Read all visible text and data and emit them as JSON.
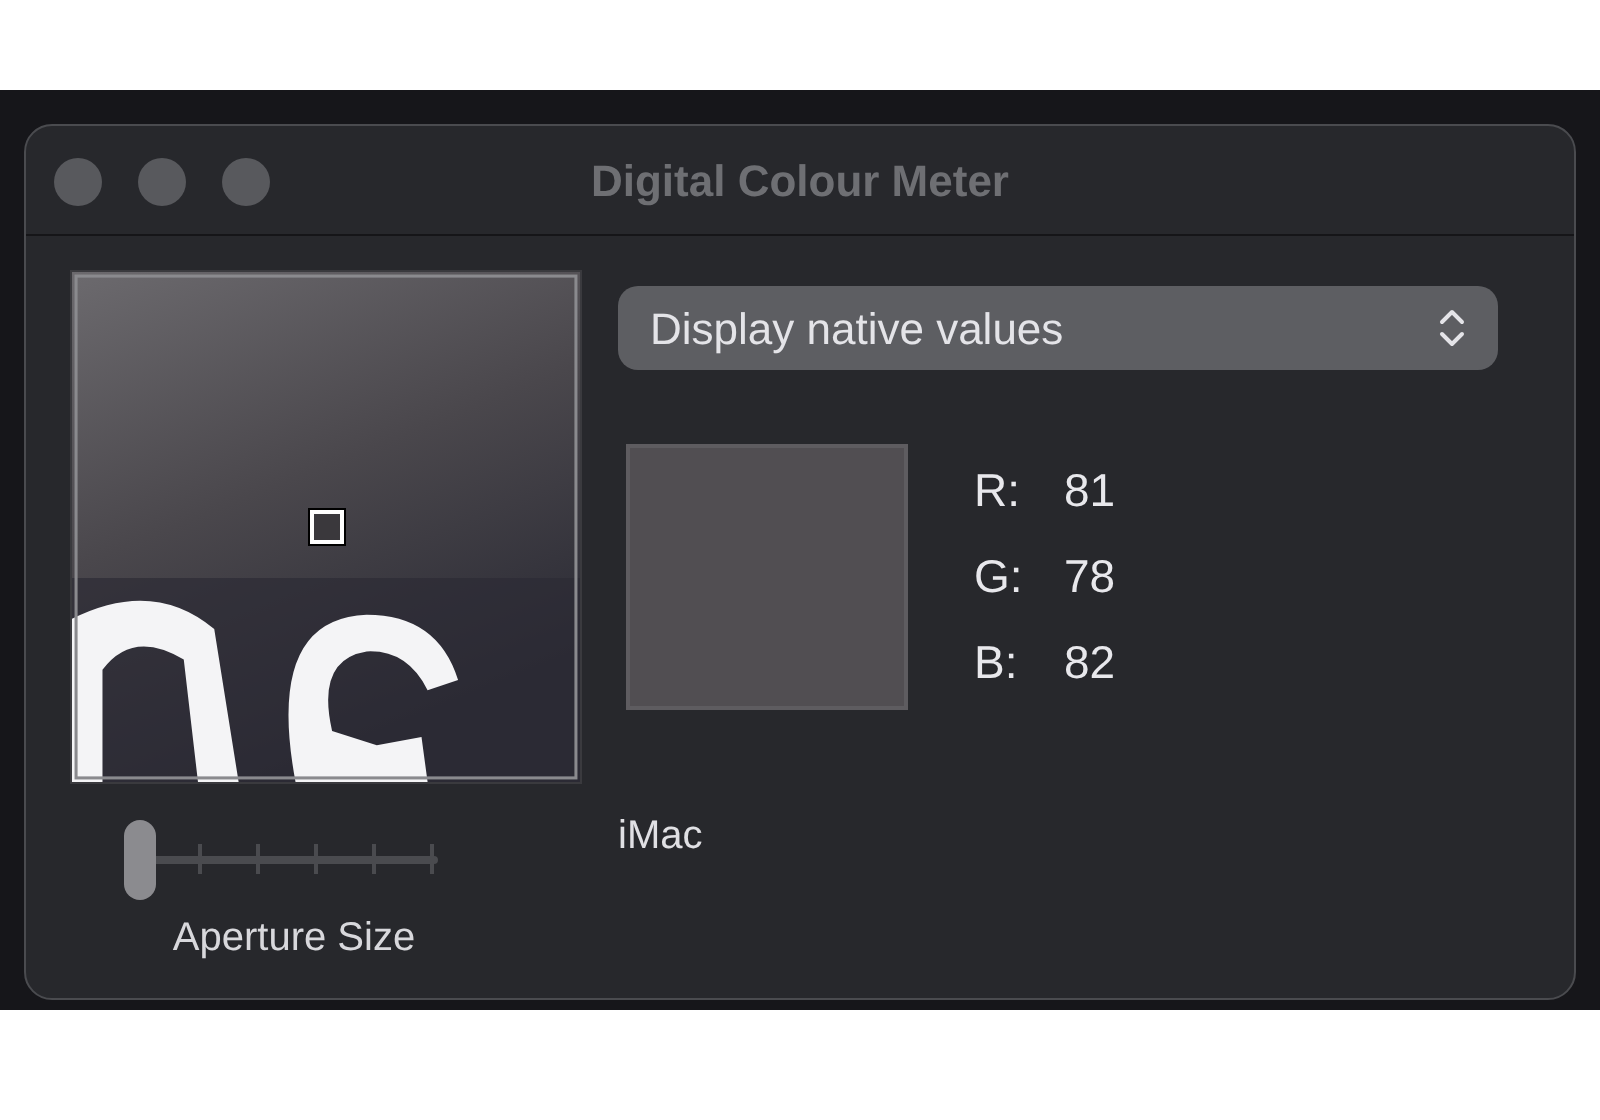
{
  "window": {
    "title": "Digital Colour Meter"
  },
  "aperture": {
    "level": 0,
    "label": "Aperture Size"
  },
  "mode_popup": {
    "value": "Display native values"
  },
  "swatch": {
    "color": "#514e52"
  },
  "channels": [
    {
      "label": "R:",
      "value": "81"
    },
    {
      "label": "G:",
      "value": "78"
    },
    {
      "label": "B:",
      "value": "82"
    }
  ],
  "display_name": "iMac"
}
